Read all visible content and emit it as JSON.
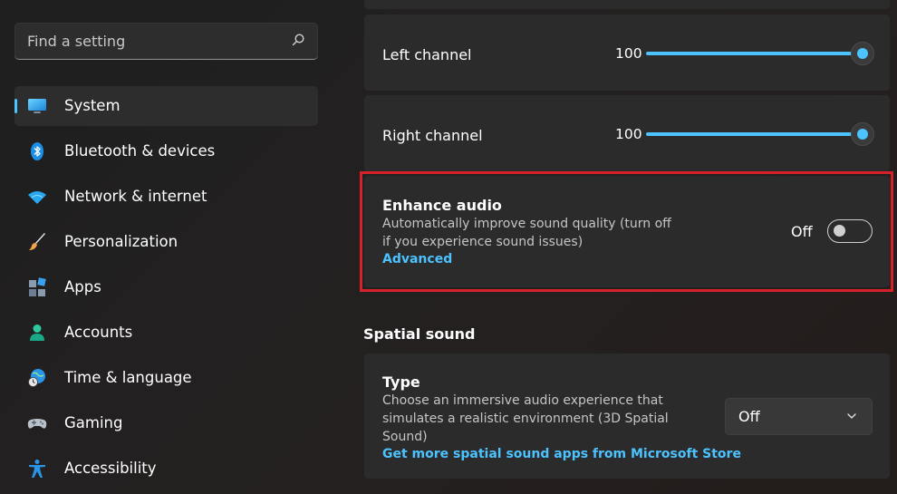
{
  "search": {
    "placeholder": "Find a setting",
    "icon": "search-icon"
  },
  "sidebar": {
    "items": [
      {
        "label": "System",
        "icon": "monitor-icon",
        "active": true
      },
      {
        "label": "Bluetooth & devices",
        "icon": "bluetooth-icon"
      },
      {
        "label": "Network & internet",
        "icon": "wifi-icon"
      },
      {
        "label": "Personalization",
        "icon": "paintbrush-icon"
      },
      {
        "label": "Apps",
        "icon": "apps-icon"
      },
      {
        "label": "Accounts",
        "icon": "person-icon"
      },
      {
        "label": "Time & language",
        "icon": "globe-clock-icon"
      },
      {
        "label": "Gaming",
        "icon": "gamepad-icon"
      },
      {
        "label": "Accessibility",
        "icon": "accessibility-icon"
      }
    ]
  },
  "balance": {
    "left": {
      "label": "Left channel",
      "value": "100",
      "level": 1.0
    },
    "right": {
      "label": "Right channel",
      "value": "100",
      "level": 1.0
    }
  },
  "enhance": {
    "title": "Enhance audio",
    "desc_line1": "Automatically improve sound quality (turn off",
    "desc_line2": "if you experience sound issues)",
    "link": "Advanced",
    "state_label": "Off",
    "on": false
  },
  "spatial": {
    "section_title": "Spatial sound",
    "type_title": "Type",
    "desc_line1": "Choose an immersive audio experience that",
    "desc_line2": "simulates a realistic environment (3D Spatial",
    "desc_line3": "Sound)",
    "link": "Get more spatial sound apps from Microsoft Store",
    "selected": "Off"
  },
  "colors": {
    "accent": "#4cc2ff",
    "highlight": "#d4212a",
    "background": "#202020",
    "card": "#2b2b2b"
  }
}
